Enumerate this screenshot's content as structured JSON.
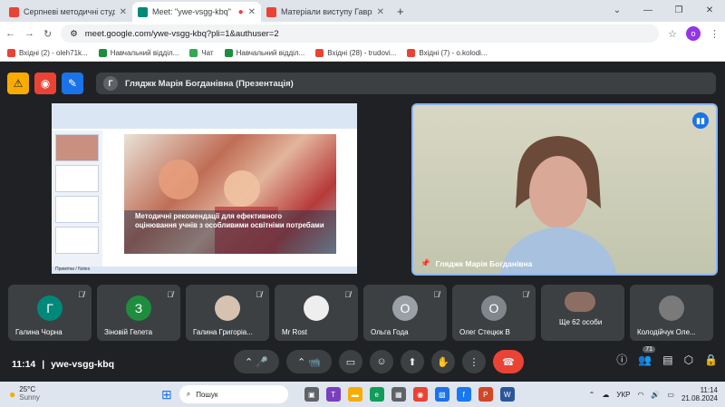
{
  "browser": {
    "tabs": [
      {
        "title": "Серпневі методичні студії - 20",
        "color": "#ea4335"
      },
      {
        "title": "Meet: \"ywe-vsgg-kbq\"",
        "color": "#00897b"
      },
      {
        "title": "Матеріали виступу Гаврилюк",
        "color": "#ea4335"
      }
    ],
    "url": "meet.google.com/ywe-vsgg-kbq?pli=1&authuser=2",
    "profile_initial": "o",
    "bookmarks": [
      {
        "label": "Вхідні (2) - oleh71k...",
        "color": "#ea4335"
      },
      {
        "label": "Навчальний відділ...",
        "color": "#1e8e3e"
      },
      {
        "label": "Чат",
        "color": "#34a853"
      },
      {
        "label": "Навчальний відділ...",
        "color": "#1e8e3e"
      },
      {
        "label": "Вхідні (28) - trudovi...",
        "color": "#ea4335"
      },
      {
        "label": "Вхідні (7) - o.kolodi...",
        "color": "#ea4335"
      }
    ]
  },
  "meet": {
    "presenter_bar": {
      "initial": "Г",
      "label": "Гляджк Марія Богданівна (Презентація)"
    },
    "slide": {
      "caption": "Методичні рекомендації для ефективного оцінювання учнів з особливими освітніми потребами",
      "status": "Примітки / Notes"
    },
    "camera": {
      "name": "Гляджк Марія Богданівна"
    },
    "participants": [
      {
        "name": "Галина Чорна",
        "initial": "Г",
        "color": "#00897b"
      },
      {
        "name": "Зіновій Гелета",
        "initial": "З",
        "color": "#1e8e3e"
      },
      {
        "name": "Галина Григоріа...",
        "initial": "",
        "color": "#d6c2b0"
      },
      {
        "name": "Mr Rost",
        "initial": "",
        "color": "#eeeeee"
      },
      {
        "name": "Ольга Года",
        "initial": "О",
        "color": "#9aa0a6"
      },
      {
        "name": "Олег Стецюк В",
        "initial": "О",
        "color": "#80868b"
      },
      {
        "name": "Ще 62 особи",
        "initial": "",
        "color": "#3c4043"
      },
      {
        "name": "Колодійчук Оле...",
        "initial": "",
        "color": "#7a7a7a"
      }
    ],
    "time": "11:14",
    "meeting_code": "ywe-vsgg-kbq",
    "participant_count": "71"
  },
  "taskbar": {
    "weather": {
      "temp": "25°C",
      "desc": "Sunny"
    },
    "search_placeholder": "Пошук",
    "lang": "УКР",
    "time": "11:14",
    "date": "21.08.2024"
  }
}
